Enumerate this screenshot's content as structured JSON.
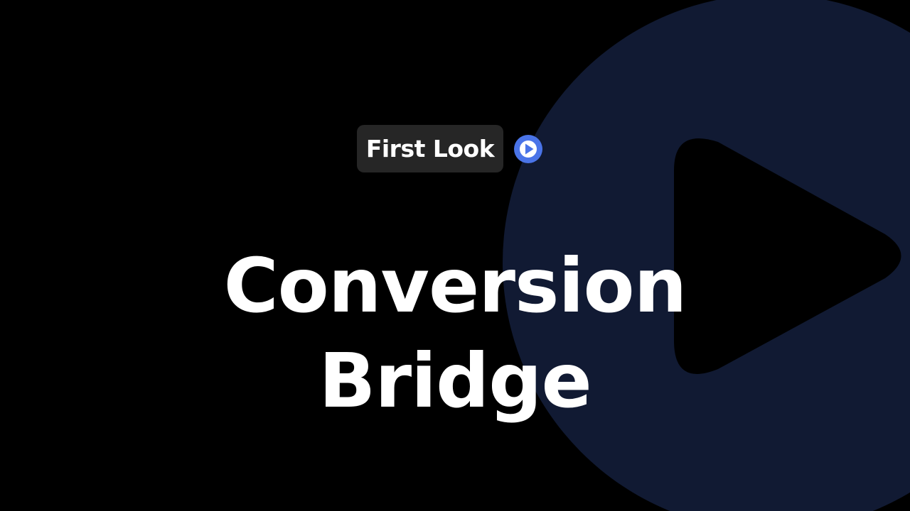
{
  "badge": {
    "label": "First Look"
  },
  "title": {
    "line1": "Conversion",
    "line2": "Bridge"
  },
  "colors": {
    "background": "#000000",
    "circle": "#111a33",
    "badge_background": "#262626",
    "play_accent": "#4a74e8",
    "text": "#ffffff"
  },
  "icons": {
    "badge_icon": "play-circle-icon",
    "background_graphic": "large-play-icon"
  }
}
